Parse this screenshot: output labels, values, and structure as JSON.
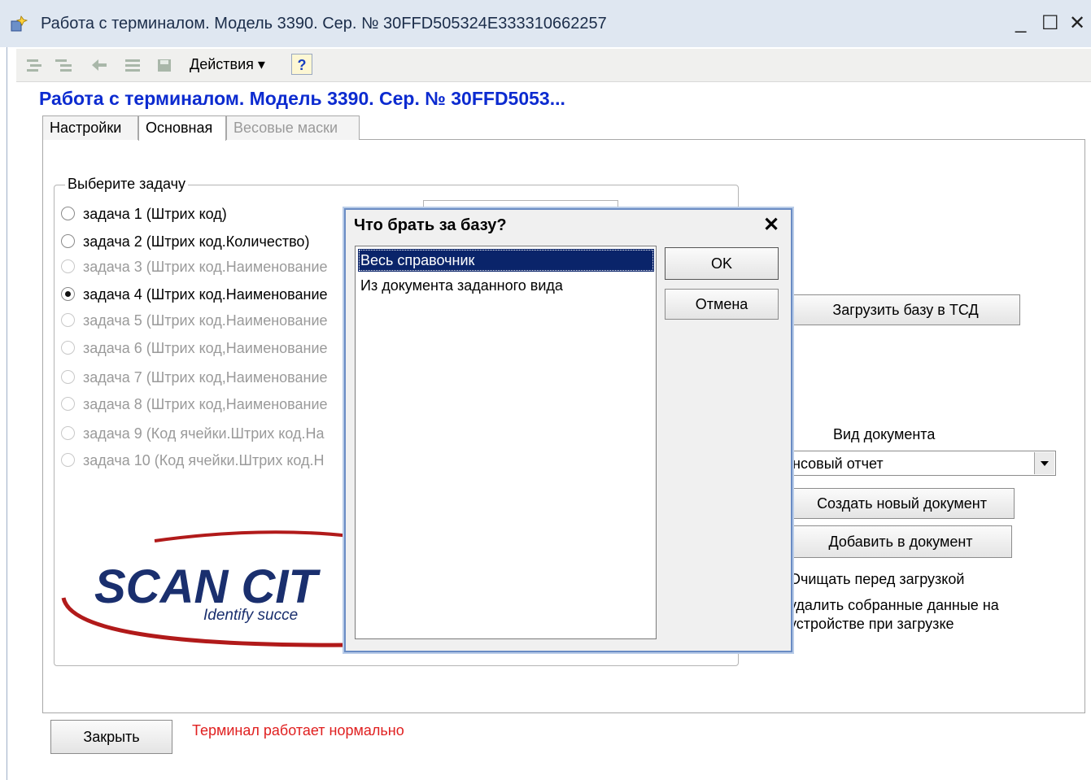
{
  "window": {
    "title": "Работа с терминалом. Модель 3390. Сер. № 30FFD505324E333310662257",
    "minimize": "_",
    "maximize": "☐",
    "close": "✕"
  },
  "toolbar": {
    "actions_label": "Действия ▾",
    "help_label": "?"
  },
  "form": {
    "title": "Работа с терминалом. Модель 3390. Сер. № 30FFD5053..."
  },
  "tabs": [
    {
      "label": "Настройки"
    },
    {
      "label": "Основная"
    },
    {
      "label": "Весовые маски"
    }
  ],
  "task_group": {
    "label": "Выберите задачу",
    "options": [
      {
        "label": "задача 1 (Штрих код)",
        "enabled": true,
        "selected": false
      },
      {
        "label": "задача 2 (Штрих код.Количество)",
        "enabled": true,
        "selected": false
      },
      {
        "label": "задача 3 (Штрих код.Наименование",
        "enabled": false,
        "selected": false
      },
      {
        "label": "задача 4 (Штрих код.Наименование",
        "enabled": true,
        "selected": true
      },
      {
        "label": "задача 5 (Штрих код.Наименование",
        "enabled": false,
        "selected": false
      },
      {
        "label": "задача 6 (Штрих код,Наименование",
        "enabled": false,
        "selected": false
      },
      {
        "label": "задача 7 (Штрих код,Наименование",
        "enabled": false,
        "selected": false
      },
      {
        "label": "задача 8 (Штрих код,Наименование",
        "enabled": false,
        "selected": false
      },
      {
        "label": "задача 9 (Код ячейки.Штрих код.На",
        "enabled": false,
        "selected": false
      },
      {
        "label": "задача 10 (Код ячейки.Штрих код.Н",
        "enabled": false,
        "selected": false
      }
    ]
  },
  "right_panel": {
    "load_base_button": "Загрузить базу в ТСД",
    "doc_type_label": "Вид документа",
    "doc_type_value": "нсовый отчет",
    "create_doc_button": "Создать новый документ",
    "add_to_doc_button": "Добавить в документ",
    "clear_before_load": "Очищать перед загрузкой",
    "delete_data_line1": "удалить собранные данные на",
    "delete_data_line2": "устройстве при загрузке"
  },
  "logo": {
    "text": "SCAN CIT",
    "tagline": "Identify succe"
  },
  "footer": {
    "close_button": "Закрыть",
    "status": "Терминал работает нормально",
    "status_color": "#e02020"
  },
  "dialog": {
    "title": "Что брать за базу?",
    "close": "✕",
    "items": [
      {
        "label": "Весь справочник",
        "selected": true
      },
      {
        "label": "Из документа заданного вида",
        "selected": false
      }
    ],
    "ok_button": "OK",
    "cancel_button": "Отмена"
  },
  "colors": {
    "form_title": "#0c2bd0",
    "selection": "#0a246a",
    "logo_blue": "#1a2f6e",
    "logo_red": "#b11a1a"
  }
}
